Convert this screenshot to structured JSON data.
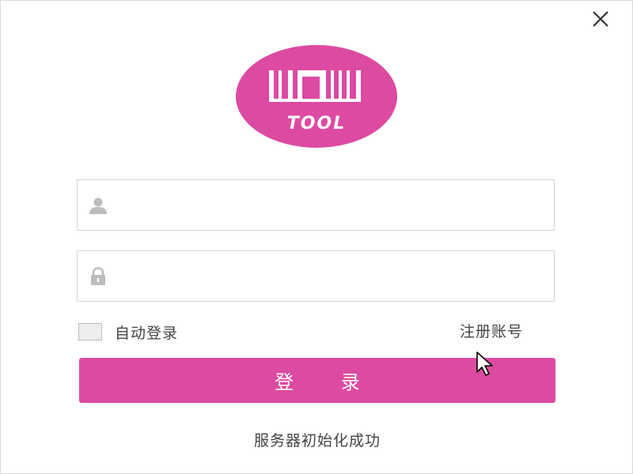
{
  "window": {
    "close_icon": "close-icon"
  },
  "logo": {
    "text": "TOOL",
    "icon": "barcode-icon",
    "color": "#dd4aa2"
  },
  "form": {
    "username": {
      "icon": "user-icon",
      "placeholder": "",
      "value": ""
    },
    "password": {
      "icon": "lock-icon",
      "placeholder": "",
      "value": ""
    },
    "auto_login": {
      "label": "自动登录",
      "checked": false
    },
    "register_label": "注册账号",
    "login_label": "登 录"
  },
  "status_text": "服务器初始化成功",
  "colors": {
    "accent": "#dd4aa2",
    "icon_gray": "#bdbdbd",
    "text": "#444444"
  }
}
